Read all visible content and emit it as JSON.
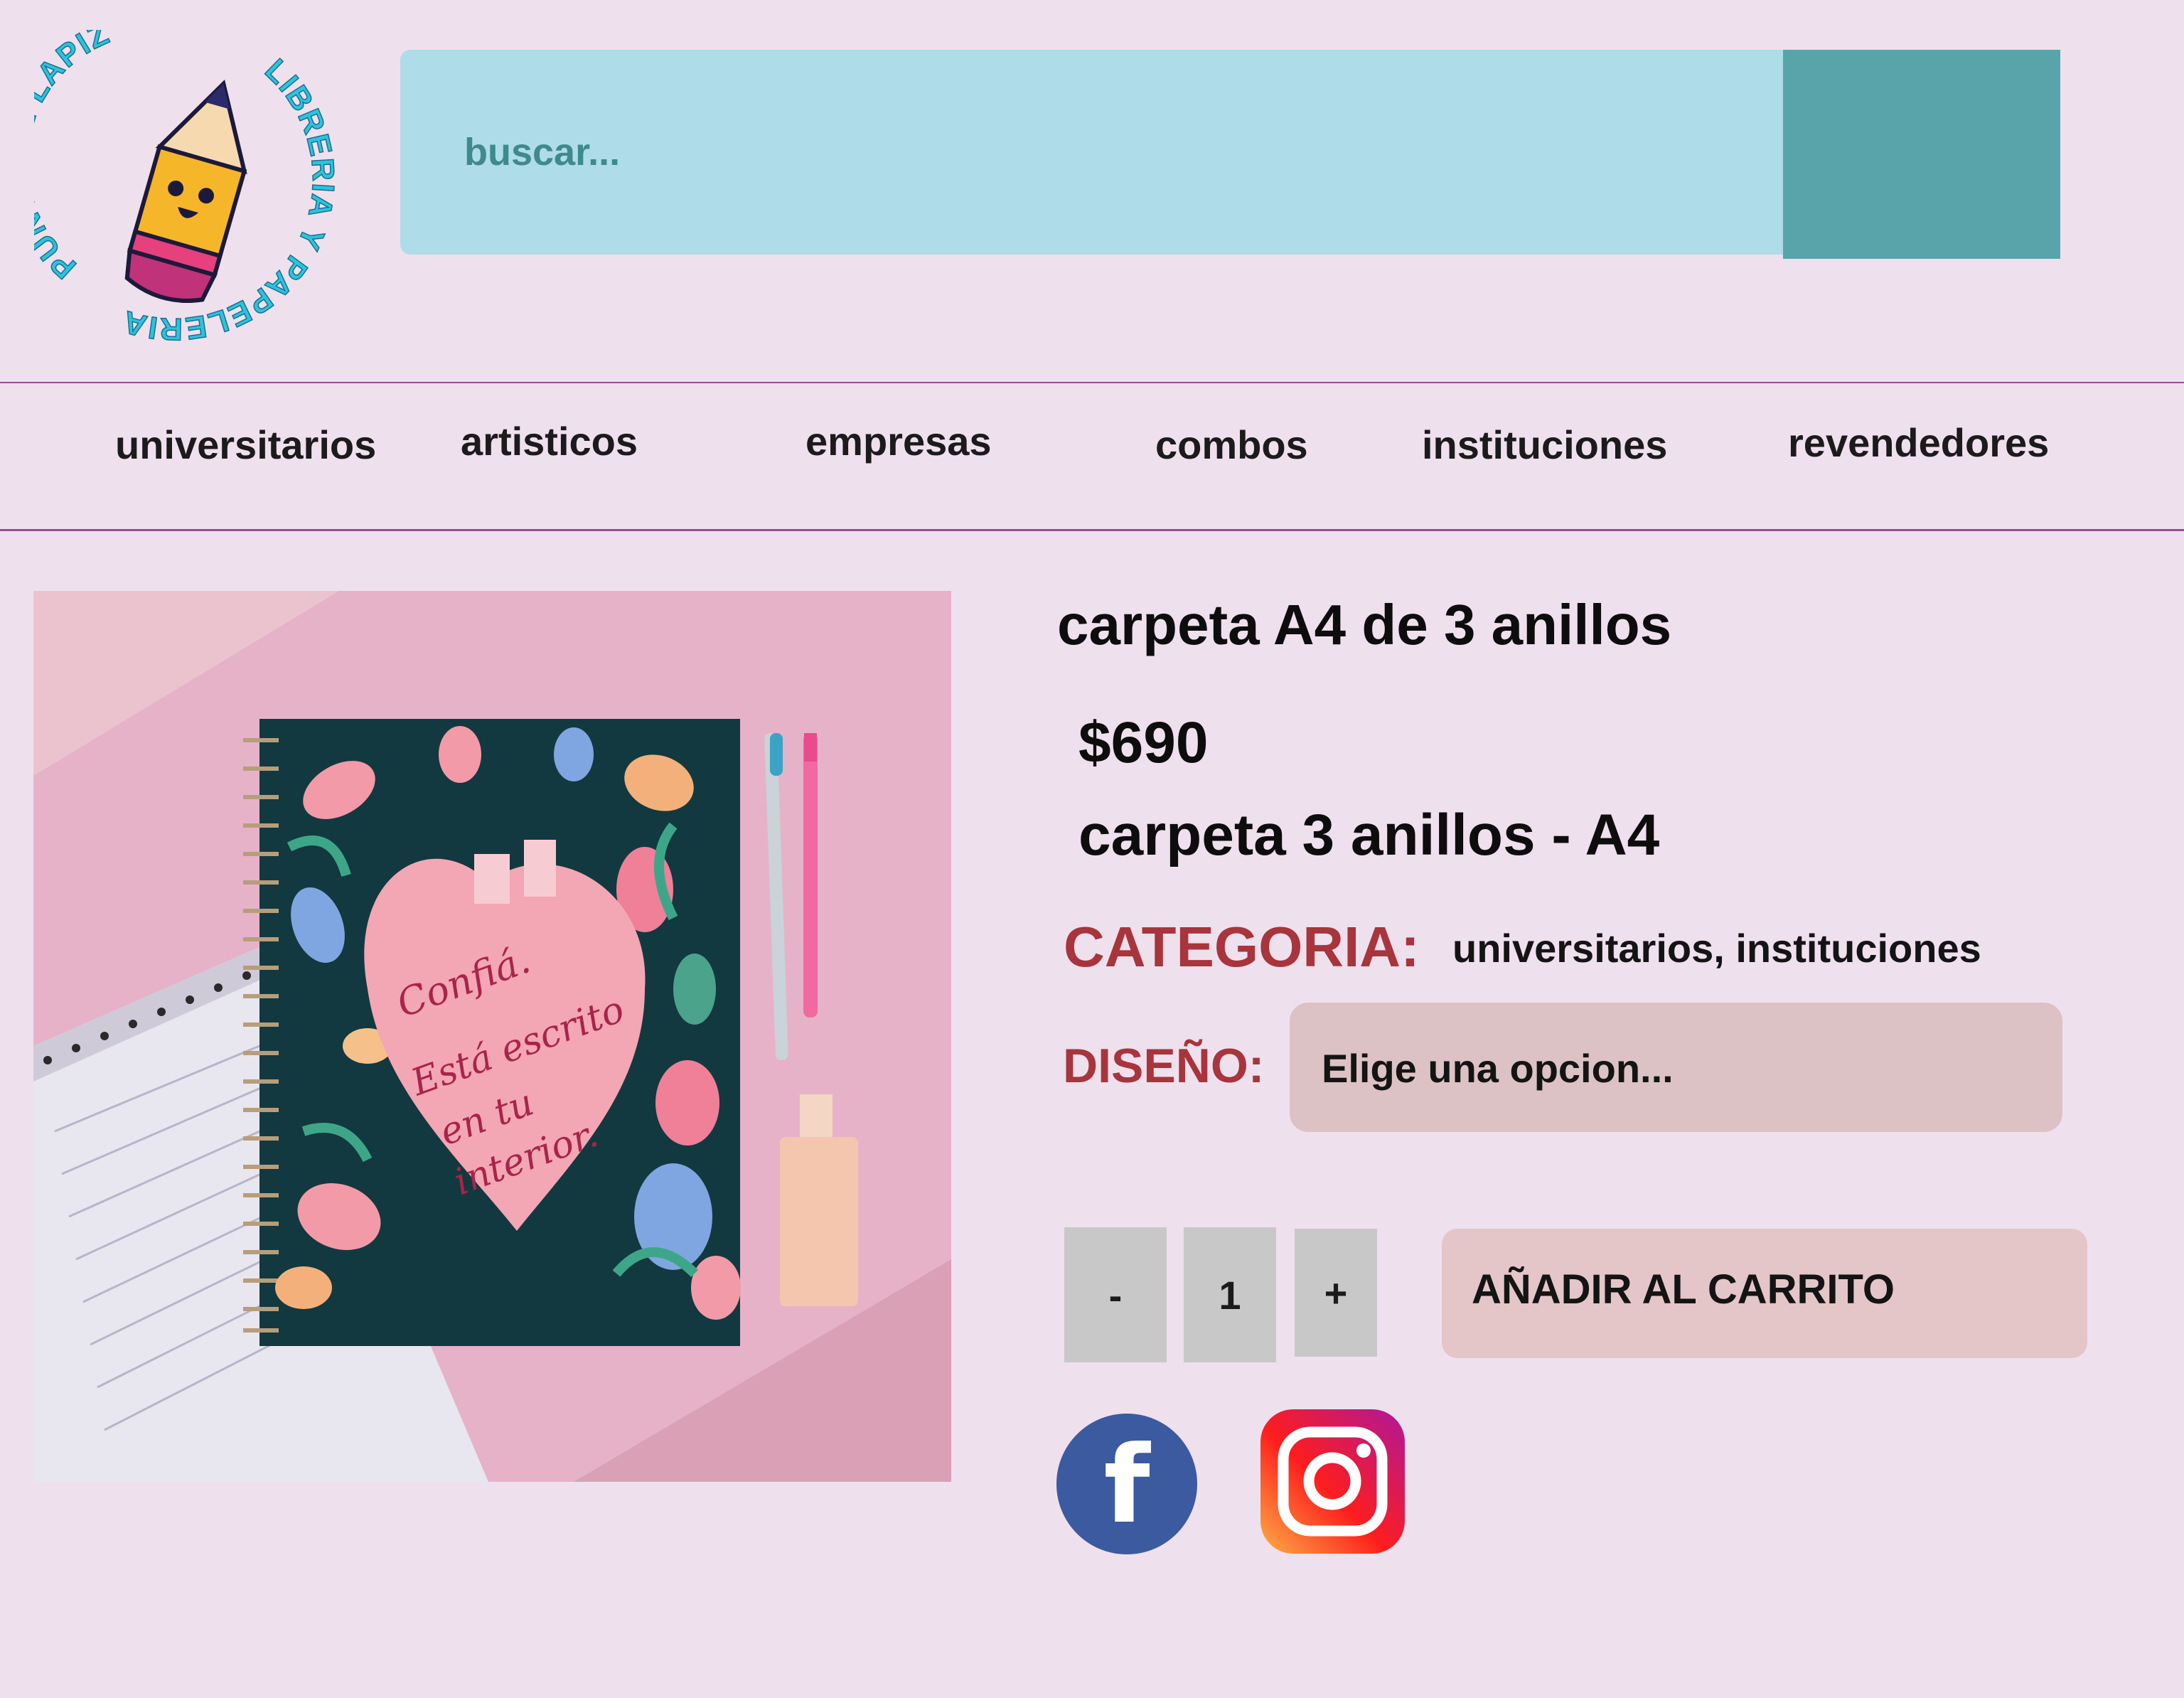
{
  "brand": {
    "ring_text_top": "PUNTA DE LAPIZ",
    "ring_text_bottom": "LIBRERIA Y PAPELERIA",
    "logo_icon": "pencil-mascot-icon"
  },
  "search": {
    "placeholder": "buscar...",
    "button_icon": "search-button"
  },
  "nav": {
    "items": [
      {
        "label": "universitarios"
      },
      {
        "label": "artisticos"
      },
      {
        "label": "empresas"
      },
      {
        "label": "combos"
      },
      {
        "label": "instituciones"
      },
      {
        "label": "revendedores"
      }
    ]
  },
  "product": {
    "image": {
      "icon": "notebook-photo",
      "handwriting": [
        "Confiá.",
        "Está escrito",
        "en tu",
        "interior."
      ]
    },
    "title": "carpeta A4 de 3 anillos",
    "price": "$690",
    "subtitle": "carpeta 3 anillos - A4",
    "category_label": "CATEGORIA:",
    "category_values": "universitarios, instituciones",
    "design_label": "DISEÑO:",
    "design_placeholder": "Elige una opcion...",
    "quantity": {
      "minus": "-",
      "value": "1",
      "plus": "+"
    },
    "add_to_cart": "AÑADIR AL CARRITO"
  },
  "social": {
    "facebook_glyph": "f",
    "facebook_icon": "facebook-icon",
    "instagram_icon": "instagram-icon"
  },
  "colors": {
    "background": "#efe0ee",
    "search_field": "#aedce8",
    "search_button": "#58a4aa",
    "accent_label": "#a8343c",
    "nav_divider": "#9a4b97",
    "select_bg": "#dcc2c4",
    "cart_bg": "#e4c6c8",
    "qty_bg": "#c8c8c8",
    "facebook": "#3b5aa0"
  }
}
